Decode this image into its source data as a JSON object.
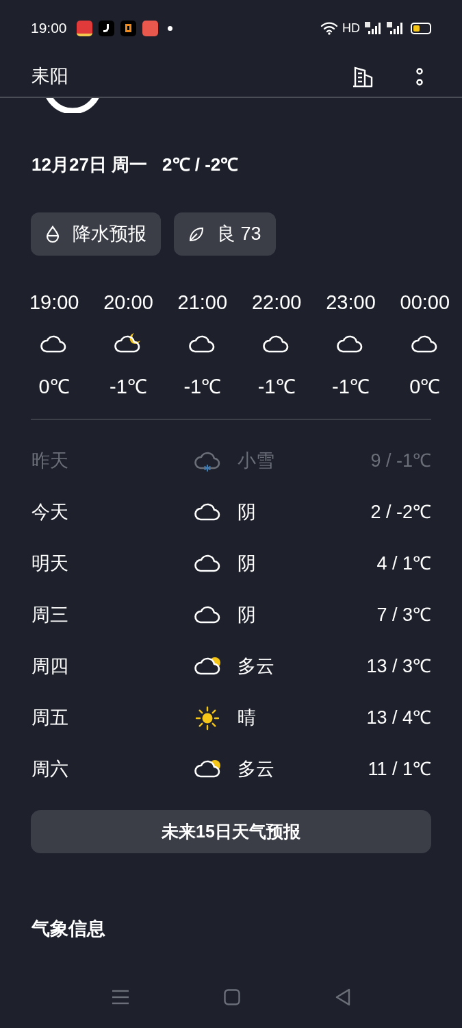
{
  "status_bar": {
    "time": "19:00",
    "network": "HD"
  },
  "header": {
    "city": "耒阳"
  },
  "summary": {
    "date": "12月27日 周一",
    "range": "2℃ / -2℃"
  },
  "chips": [
    {
      "kind": "rain",
      "label": "降水预报"
    },
    {
      "kind": "air",
      "label": "良 73"
    }
  ],
  "hourly": [
    {
      "time": "19:00",
      "kind": "cloudy",
      "temp": "0℃"
    },
    {
      "time": "20:00",
      "kind": "cloudy-night",
      "temp": "-1℃"
    },
    {
      "time": "21:00",
      "kind": "cloudy",
      "temp": "-1℃"
    },
    {
      "time": "22:00",
      "kind": "cloudy",
      "temp": "-1℃"
    },
    {
      "time": "23:00",
      "kind": "cloudy",
      "temp": "-1℃"
    },
    {
      "time": "00:00",
      "kind": "cloudy",
      "temp": "0℃"
    }
  ],
  "daily": [
    {
      "day": "昨天",
      "kind": "snow",
      "condition": "小雪",
      "range": "9 / -1℃",
      "past": true
    },
    {
      "day": "今天",
      "kind": "cloudy",
      "condition": "阴",
      "range": "2 / -2℃",
      "past": false
    },
    {
      "day": "明天",
      "kind": "cloudy",
      "condition": "阴",
      "range": "4 / 1℃",
      "past": false
    },
    {
      "day": "周三",
      "kind": "cloudy",
      "condition": "阴",
      "range": "7 / 3℃",
      "past": false
    },
    {
      "day": "周四",
      "kind": "partly-cloudy",
      "condition": "多云",
      "range": "13 / 3℃",
      "past": false
    },
    {
      "day": "周五",
      "kind": "sunny",
      "condition": "晴",
      "range": "13 / 4℃",
      "past": false
    },
    {
      "day": "周六",
      "kind": "partly-cloudy",
      "condition": "多云",
      "range": "11 / 1℃",
      "past": false
    }
  ],
  "forecast_button": "未来15日天气预报",
  "section_title": "气象信息"
}
